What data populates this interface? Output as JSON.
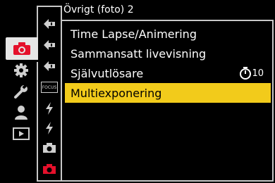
{
  "header": {
    "title": "Övrigt (foto) 2"
  },
  "main_tabs": [
    {
      "name": "camera",
      "icon": "camera-icon",
      "active": true
    },
    {
      "name": "gear",
      "icon": "gear-icon",
      "active": false
    },
    {
      "name": "wrench",
      "icon": "wrench-icon",
      "active": false
    },
    {
      "name": "person",
      "icon": "person-icon",
      "active": false
    },
    {
      "name": "playback",
      "icon": "playback-icon",
      "active": false
    }
  ],
  "sub_tabs": [
    {
      "icon": "quality-icon"
    },
    {
      "icon": "quality-icon"
    },
    {
      "icon": "quality-icon"
    },
    {
      "icon": "focus-icon",
      "label": "FOCUS"
    },
    {
      "icon": "flash-icon"
    },
    {
      "icon": "flash-icon"
    },
    {
      "icon": "camera-small-icon"
    },
    {
      "icon": "camera-small-icon",
      "active": true
    }
  ],
  "menu": {
    "items": [
      {
        "label": "Time Lapse/Animering",
        "value": ""
      },
      {
        "label": "Sammansatt livevisning",
        "value": ""
      },
      {
        "label": "Självutlösare",
        "value": "10",
        "value_icon": "self-timer-icon"
      },
      {
        "label": "Multiexponering",
        "value": "",
        "selected": true
      }
    ]
  },
  "colors": {
    "accent": "#f2cb1b",
    "active_red": "#e5102b",
    "frame": "#c8c8c8"
  }
}
